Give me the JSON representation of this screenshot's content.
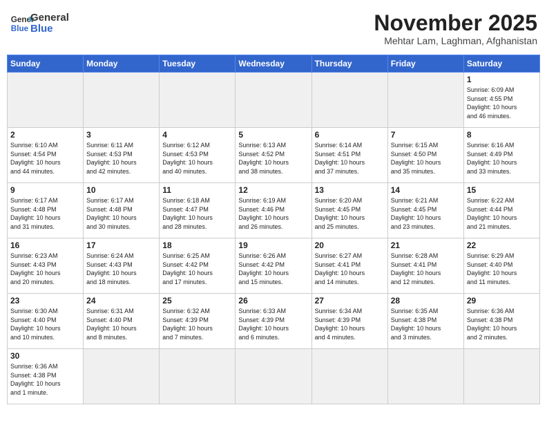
{
  "header": {
    "title": "November 2025",
    "location": "Mehtar Lam, Laghman, Afghanistan"
  },
  "logo": {
    "line1": "General",
    "line2": "Blue"
  },
  "days_of_week": [
    "Sunday",
    "Monday",
    "Tuesday",
    "Wednesday",
    "Thursday",
    "Friday",
    "Saturday"
  ],
  "weeks": [
    [
      {
        "day": "",
        "info": ""
      },
      {
        "day": "",
        "info": ""
      },
      {
        "day": "",
        "info": ""
      },
      {
        "day": "",
        "info": ""
      },
      {
        "day": "",
        "info": ""
      },
      {
        "day": "",
        "info": ""
      },
      {
        "day": "1",
        "info": "Sunrise: 6:09 AM\nSunset: 4:55 PM\nDaylight: 10 hours\nand 46 minutes."
      }
    ],
    [
      {
        "day": "2",
        "info": "Sunrise: 6:10 AM\nSunset: 4:54 PM\nDaylight: 10 hours\nand 44 minutes."
      },
      {
        "day": "3",
        "info": "Sunrise: 6:11 AM\nSunset: 4:53 PM\nDaylight: 10 hours\nand 42 minutes."
      },
      {
        "day": "4",
        "info": "Sunrise: 6:12 AM\nSunset: 4:53 PM\nDaylight: 10 hours\nand 40 minutes."
      },
      {
        "day": "5",
        "info": "Sunrise: 6:13 AM\nSunset: 4:52 PM\nDaylight: 10 hours\nand 38 minutes."
      },
      {
        "day": "6",
        "info": "Sunrise: 6:14 AM\nSunset: 4:51 PM\nDaylight: 10 hours\nand 37 minutes."
      },
      {
        "day": "7",
        "info": "Sunrise: 6:15 AM\nSunset: 4:50 PM\nDaylight: 10 hours\nand 35 minutes."
      },
      {
        "day": "8",
        "info": "Sunrise: 6:16 AM\nSunset: 4:49 PM\nDaylight: 10 hours\nand 33 minutes."
      }
    ],
    [
      {
        "day": "9",
        "info": "Sunrise: 6:17 AM\nSunset: 4:48 PM\nDaylight: 10 hours\nand 31 minutes."
      },
      {
        "day": "10",
        "info": "Sunrise: 6:17 AM\nSunset: 4:48 PM\nDaylight: 10 hours\nand 30 minutes."
      },
      {
        "day": "11",
        "info": "Sunrise: 6:18 AM\nSunset: 4:47 PM\nDaylight: 10 hours\nand 28 minutes."
      },
      {
        "day": "12",
        "info": "Sunrise: 6:19 AM\nSunset: 4:46 PM\nDaylight: 10 hours\nand 26 minutes."
      },
      {
        "day": "13",
        "info": "Sunrise: 6:20 AM\nSunset: 4:45 PM\nDaylight: 10 hours\nand 25 minutes."
      },
      {
        "day": "14",
        "info": "Sunrise: 6:21 AM\nSunset: 4:45 PM\nDaylight: 10 hours\nand 23 minutes."
      },
      {
        "day": "15",
        "info": "Sunrise: 6:22 AM\nSunset: 4:44 PM\nDaylight: 10 hours\nand 21 minutes."
      }
    ],
    [
      {
        "day": "16",
        "info": "Sunrise: 6:23 AM\nSunset: 4:43 PM\nDaylight: 10 hours\nand 20 minutes."
      },
      {
        "day": "17",
        "info": "Sunrise: 6:24 AM\nSunset: 4:43 PM\nDaylight: 10 hours\nand 18 minutes."
      },
      {
        "day": "18",
        "info": "Sunrise: 6:25 AM\nSunset: 4:42 PM\nDaylight: 10 hours\nand 17 minutes."
      },
      {
        "day": "19",
        "info": "Sunrise: 6:26 AM\nSunset: 4:42 PM\nDaylight: 10 hours\nand 15 minutes."
      },
      {
        "day": "20",
        "info": "Sunrise: 6:27 AM\nSunset: 4:41 PM\nDaylight: 10 hours\nand 14 minutes."
      },
      {
        "day": "21",
        "info": "Sunrise: 6:28 AM\nSunset: 4:41 PM\nDaylight: 10 hours\nand 12 minutes."
      },
      {
        "day": "22",
        "info": "Sunrise: 6:29 AM\nSunset: 4:40 PM\nDaylight: 10 hours\nand 11 minutes."
      }
    ],
    [
      {
        "day": "23",
        "info": "Sunrise: 6:30 AM\nSunset: 4:40 PM\nDaylight: 10 hours\nand 10 minutes."
      },
      {
        "day": "24",
        "info": "Sunrise: 6:31 AM\nSunset: 4:40 PM\nDaylight: 10 hours\nand 8 minutes."
      },
      {
        "day": "25",
        "info": "Sunrise: 6:32 AM\nSunset: 4:39 PM\nDaylight: 10 hours\nand 7 minutes."
      },
      {
        "day": "26",
        "info": "Sunrise: 6:33 AM\nSunset: 4:39 PM\nDaylight: 10 hours\nand 6 minutes."
      },
      {
        "day": "27",
        "info": "Sunrise: 6:34 AM\nSunset: 4:39 PM\nDaylight: 10 hours\nand 4 minutes."
      },
      {
        "day": "28",
        "info": "Sunrise: 6:35 AM\nSunset: 4:38 PM\nDaylight: 10 hours\nand 3 minutes."
      },
      {
        "day": "29",
        "info": "Sunrise: 6:36 AM\nSunset: 4:38 PM\nDaylight: 10 hours\nand 2 minutes."
      }
    ],
    [
      {
        "day": "30",
        "info": "Sunrise: 6:36 AM\nSunset: 4:38 PM\nDaylight: 10 hours\nand 1 minute."
      },
      {
        "day": "",
        "info": ""
      },
      {
        "day": "",
        "info": ""
      },
      {
        "day": "",
        "info": ""
      },
      {
        "day": "",
        "info": ""
      },
      {
        "day": "",
        "info": ""
      },
      {
        "day": "",
        "info": ""
      }
    ]
  ]
}
